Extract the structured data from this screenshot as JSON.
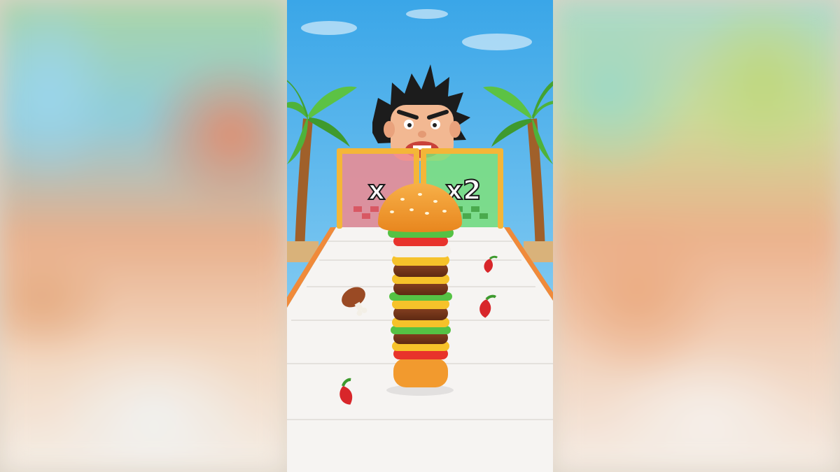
{
  "gates": {
    "left_label": "x",
    "right_label": "x2"
  },
  "colors": {
    "sky_top": "#3aa6e8",
    "sky_bottom": "#9fd8f5",
    "track": "#f6f4f2",
    "gate_frame": "#f4b638",
    "gate_left_panel": "#f08a8f",
    "gate_right_panel": "#7fe07a",
    "bun": "#f29a2e",
    "patty": "#7a3a1c",
    "cheese": "#f6c22a",
    "lettuce": "#55c244",
    "tomato": "#e8332b",
    "chili": "#d8262a"
  },
  "items": {
    "burger_stack_layers": 6,
    "pickups": [
      "chili-pepper",
      "chili-pepper",
      "chili-pepper",
      "meat-drumstick"
    ]
  }
}
